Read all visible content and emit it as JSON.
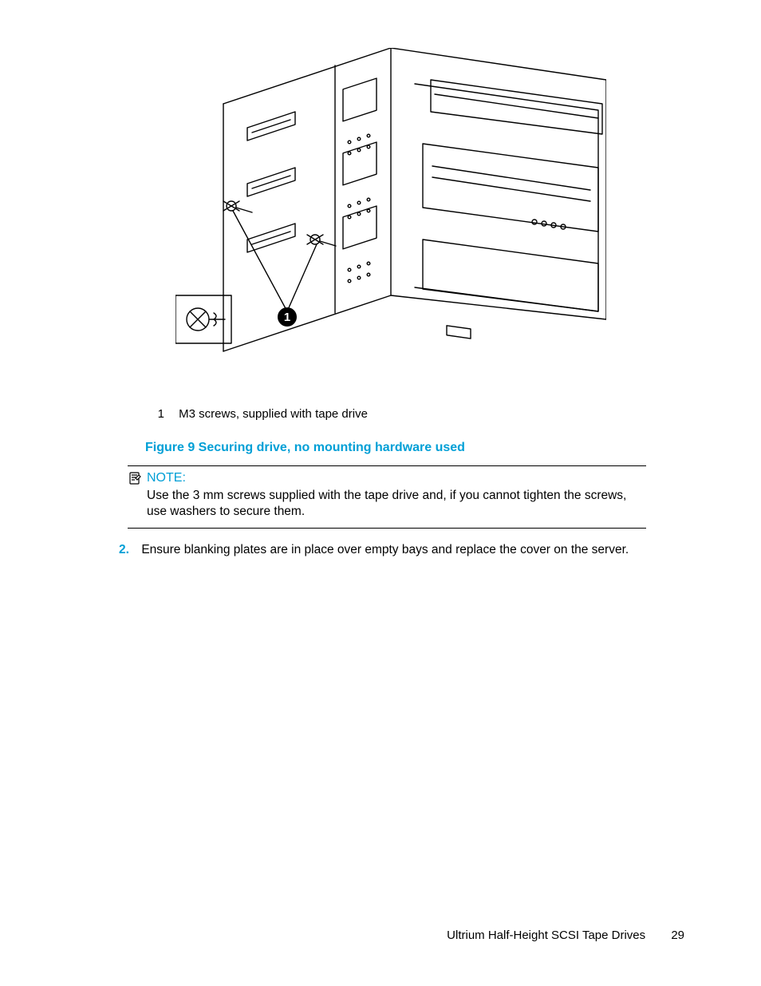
{
  "callouts": [
    {
      "num": "1",
      "text": "M3 screws, supplied with tape drive"
    }
  ],
  "figure_caption": "Figure 9 Securing drive, no mounting hardware used",
  "note": {
    "label": "NOTE:",
    "body": "Use the 3 mm screws supplied with the tape drive and, if you cannot tighten the screws, use washers to secure them."
  },
  "steps": [
    {
      "num": "2.",
      "text": "Ensure blanking plates are in place over empty bays and replace the cover on the server."
    }
  ],
  "footer": {
    "doc_title": "Ultrium Half-Height SCSI Tape Drives",
    "page_number": "29"
  },
  "callout_marker": "1"
}
